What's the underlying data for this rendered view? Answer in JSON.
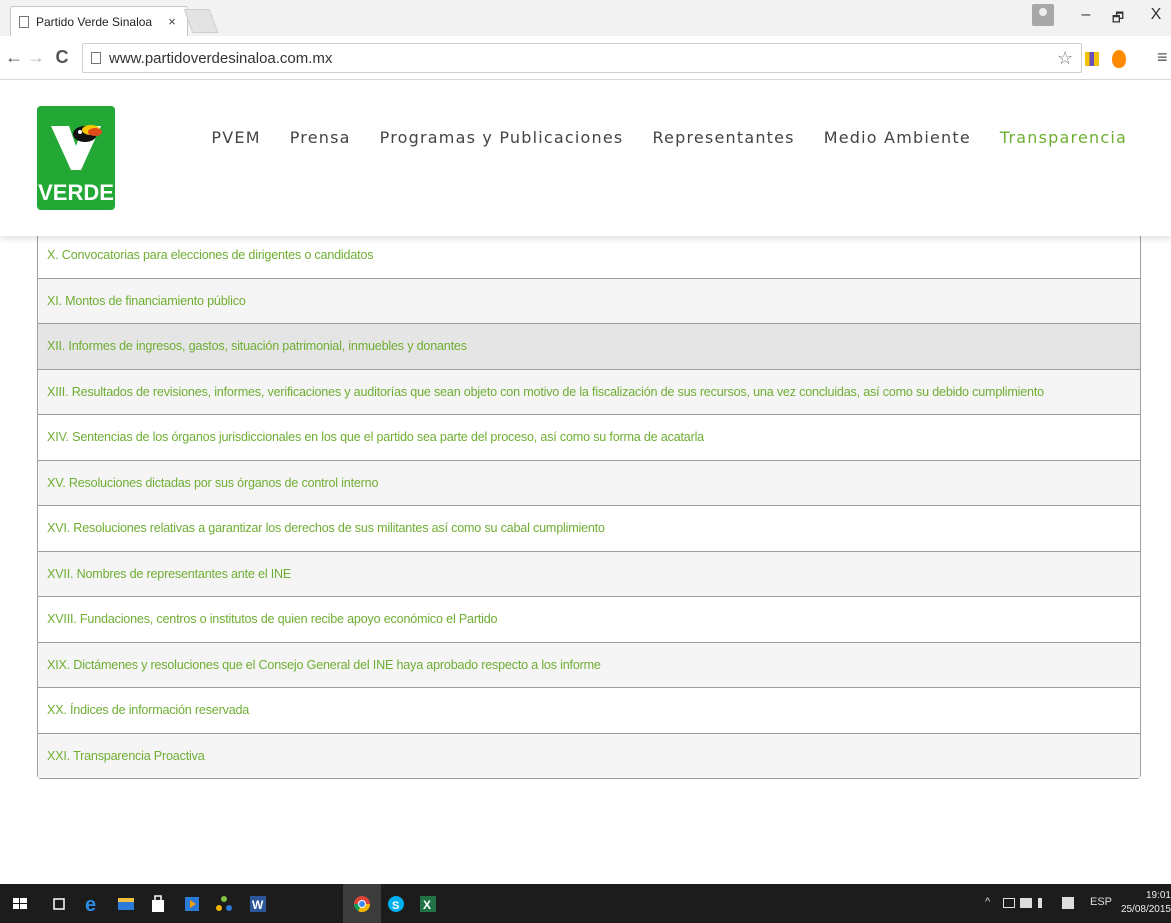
{
  "browser": {
    "tab_title": "Partido Verde Sinaloa",
    "tab_close": "×",
    "url": "www.partidoverdesinaloa.com.mx",
    "window_controls": {
      "minimize": "–",
      "maximize": "🗗",
      "close": "X"
    },
    "nav": {
      "back": "←",
      "forward": "→",
      "reload": "C"
    },
    "star": "☆",
    "menu": "≡"
  },
  "site": {
    "logo_text": "VERDE",
    "nav": [
      {
        "label": "PVEM"
      },
      {
        "label": "Prensa"
      },
      {
        "label": "Programas y Publicaciones"
      },
      {
        "label": "Representantes"
      },
      {
        "label": "Medio Ambiente"
      },
      {
        "label": "Transparencia",
        "active": true
      }
    ],
    "accent_color": "#6fae33"
  },
  "list_items": [
    "X. Convocatorias para elecciones de dirigentes o candidatos",
    "XI. Montos de financiamiento público",
    "XII. Informes de ingresos, gastos, situación patrimonial, inmuebles y donantes",
    "XIII. Resultados de revisiones, informes, verificaciones y auditorías que sean objeto con motivo de la fiscalización de sus recursos, una vez concluidas, así como su debido cumplimiento",
    "XIV. Sentencias de los órganos jurisdiccionales en los que el partido sea parte del proceso, así como su forma de acatarla",
    "XV. Resoluciones dictadas por sus órganos de control interno",
    "XVI. Resoluciones relativas a garantizar los derechos de sus militantes así como su cabal cumplimiento",
    "XVII. Nombres de representantes ante el INE",
    "XVIII. Fundaciones, centros o institutos de quien recibe apoyo económico el Partido",
    "XIX. Dictámenes y resoluciones que el Consejo General del INE haya aprobado respecto a los informe",
    "XX. Índices de información reservada",
    "XXI. Transparencia Proactiva"
  ],
  "taskbar": {
    "tray_text": "ESP",
    "time": "19:01",
    "date": "25/08/2015"
  }
}
